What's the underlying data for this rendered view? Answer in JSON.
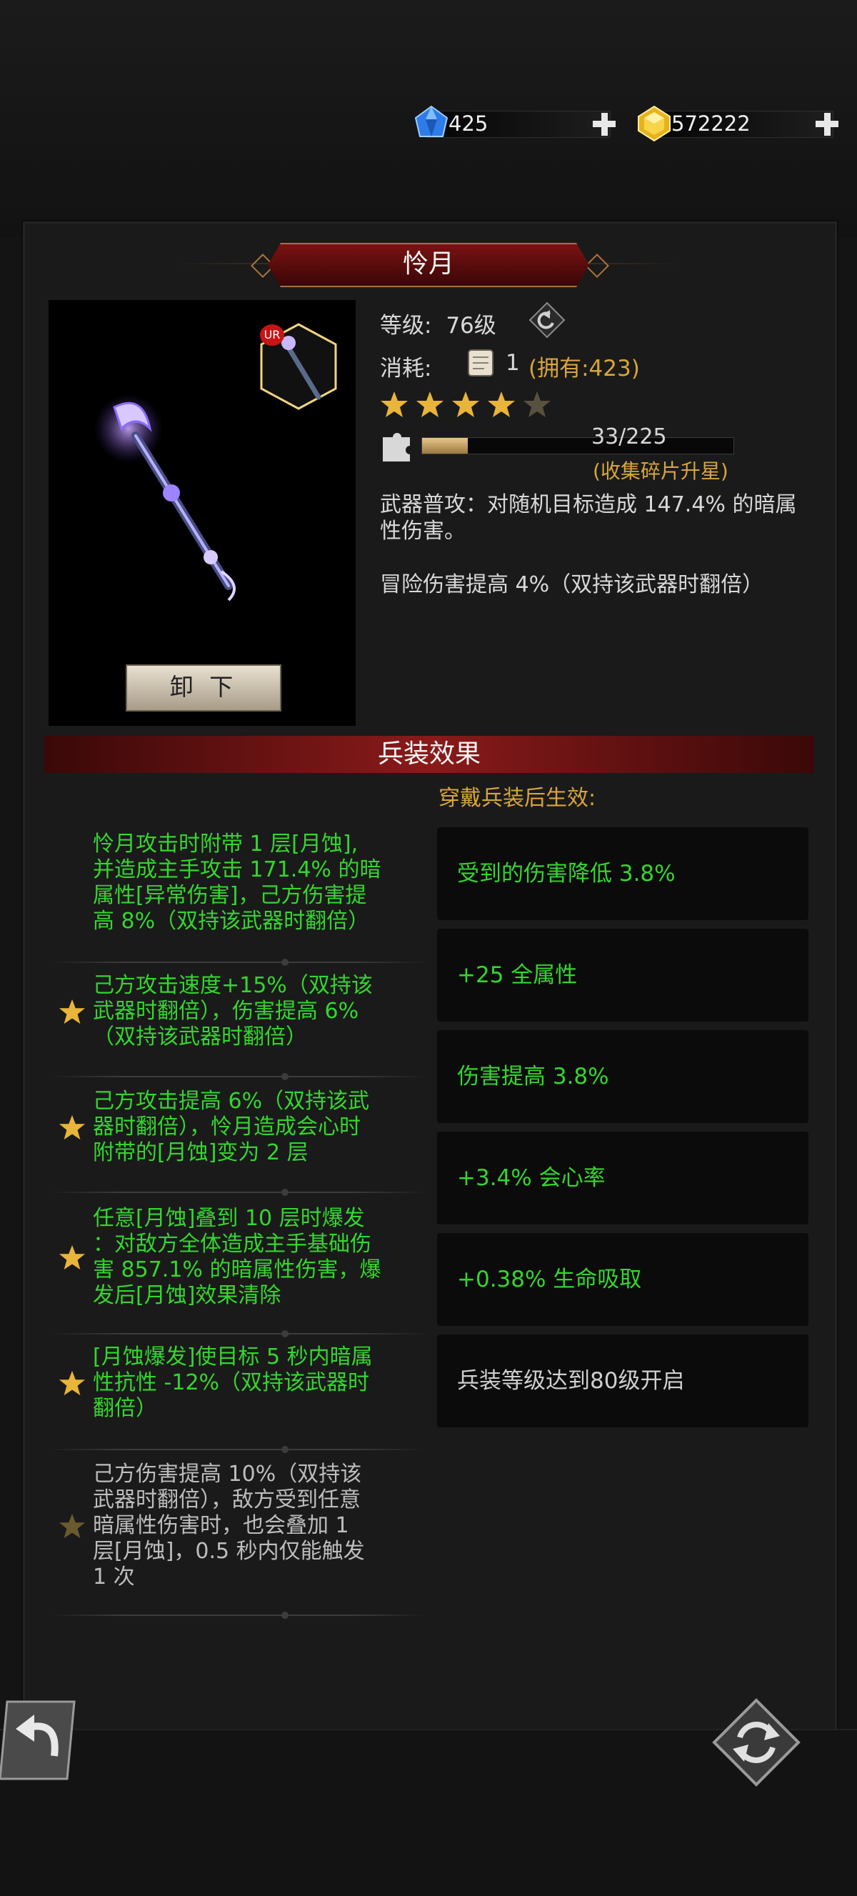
{
  "currency": {
    "diamonds": "425",
    "gold": "572222"
  },
  "weapon": {
    "name": "怜月",
    "rarity": "UR",
    "level_label": "等级:",
    "level_value": "76级",
    "cost_label": "消耗:",
    "cost_amount": "1",
    "cost_owned": "(拥有:423)",
    "stars_filled": 4,
    "stars_total": 5,
    "shard_progress_text": "33/225",
    "shard_progress_fraction": 0.1467,
    "shard_hint": "(收集碎片升星)",
    "attack_desc": "武器普攻：对随机目标造成 147.4% 的暗属性伤害。",
    "passive_desc": "冒险伤害提高 4%（双持该武器时翻倍）",
    "unequip_label": "卸 下"
  },
  "effects": {
    "header": "兵装效果",
    "right_header": "穿戴兵装后生效:",
    "left_items": [
      {
        "lines": [
          "怜月攻击时附带 1 层[月蚀],",
          "并造成主手攻击 171.4% 的暗",
          "属性[异常伤害]，己方伤害提",
          "高 8%（双持该武器时翻倍）"
        ],
        "star": false,
        "active": true
      },
      {
        "lines": [
          "己方攻击速度+15%（双持该",
          "武器时翻倍），伤害提高 6%",
          "（双持该武器时翻倍）"
        ],
        "star": true,
        "active": true
      },
      {
        "lines": [
          "己方攻击提高 6%（双持该武",
          "器时翻倍），怜月造成会心时",
          "附带的[月蚀]变为 2 层"
        ],
        "star": true,
        "active": true
      },
      {
        "lines": [
          "任意[月蚀]叠到 10 层时爆发",
          "：对敌方全体造成主手基础伤",
          "害 857.1% 的暗属性伤害，爆",
          "发后[月蚀]效果清除"
        ],
        "star": true,
        "active": true
      },
      {
        "lines": [
          "[月蚀爆发]使目标 5 秒内暗属",
          "性抗性 -12%（双持该武器时",
          "翻倍）"
        ],
        "star": true,
        "active": true
      },
      {
        "lines": [
          "己方伤害提高 10%（双持该",
          "武器时翻倍），敌方受到任意",
          "暗属性伤害时，也会叠加 1",
          "层[月蚀]，0.5 秒内仅能触发",
          "1 次"
        ],
        "star": true,
        "active": false
      }
    ],
    "right_items": [
      {
        "text": "受到的伤害降低 3.8%",
        "active": true
      },
      {
        "text": "+25 全属性",
        "active": true
      },
      {
        "text": "伤害提高 3.8%",
        "active": true
      },
      {
        "text": "+3.4% 会心率",
        "active": true
      },
      {
        "text": "+0.38% 生命吸取",
        "active": true
      },
      {
        "text": "兵装等级达到80级开启",
        "active": false
      }
    ]
  },
  "icons": {
    "diamond": "blue-gem-icon",
    "gold": "gold-gem-icon",
    "add": "plus-icon",
    "swap": "swap-icon",
    "scroll": "scroll-icon",
    "puzzle": "puzzle-icon",
    "back": "back-arrow-icon",
    "refresh": "refresh-icon"
  },
  "colors": {
    "effect_active": "#34d62e",
    "effect_inactive": "#bdbdbd",
    "orange_text": "#d8a63a",
    "banner_red": "#7a1212"
  }
}
